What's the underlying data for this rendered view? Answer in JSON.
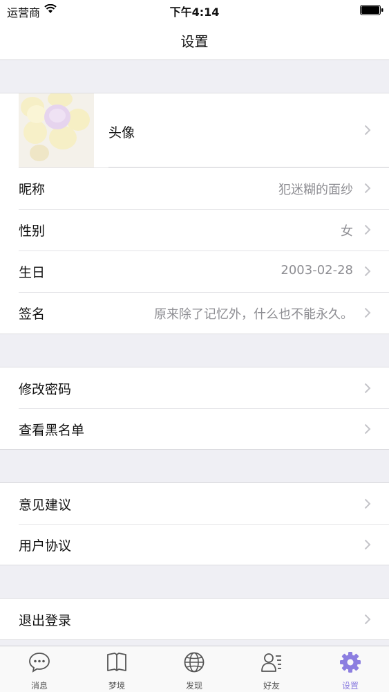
{
  "status_bar": {
    "carrier": "运营商",
    "time": "下午4:14"
  },
  "nav": {
    "title": "设置"
  },
  "profile": {
    "avatar_label": "头像",
    "nickname_label": "昵称",
    "nickname_value": "犯迷糊的面纱",
    "gender_label": "性别",
    "gender_value": "女",
    "birthday_label": "生日",
    "birthday_value": "2003-02-28",
    "signature_label": "签名",
    "signature_value": "原来除了记忆外，什么也不能永久。"
  },
  "account": {
    "change_password": "修改密码",
    "blacklist": "查看黑名单"
  },
  "support": {
    "feedback": "意见建议",
    "user_agreement": "用户协议"
  },
  "logout": {
    "label": "退出登录"
  },
  "tabs": [
    {
      "label": "消息",
      "icon": "chat-bubble-icon"
    },
    {
      "label": "梦境",
      "icon": "book-icon"
    },
    {
      "label": "发现",
      "icon": "globe-icon"
    },
    {
      "label": "好友",
      "icon": "contacts-icon"
    },
    {
      "label": "设置",
      "icon": "gear-icon"
    }
  ],
  "colors": {
    "accent": "#8c7ee0",
    "background": "#efeff4",
    "secondary_text": "#8e8e93"
  }
}
